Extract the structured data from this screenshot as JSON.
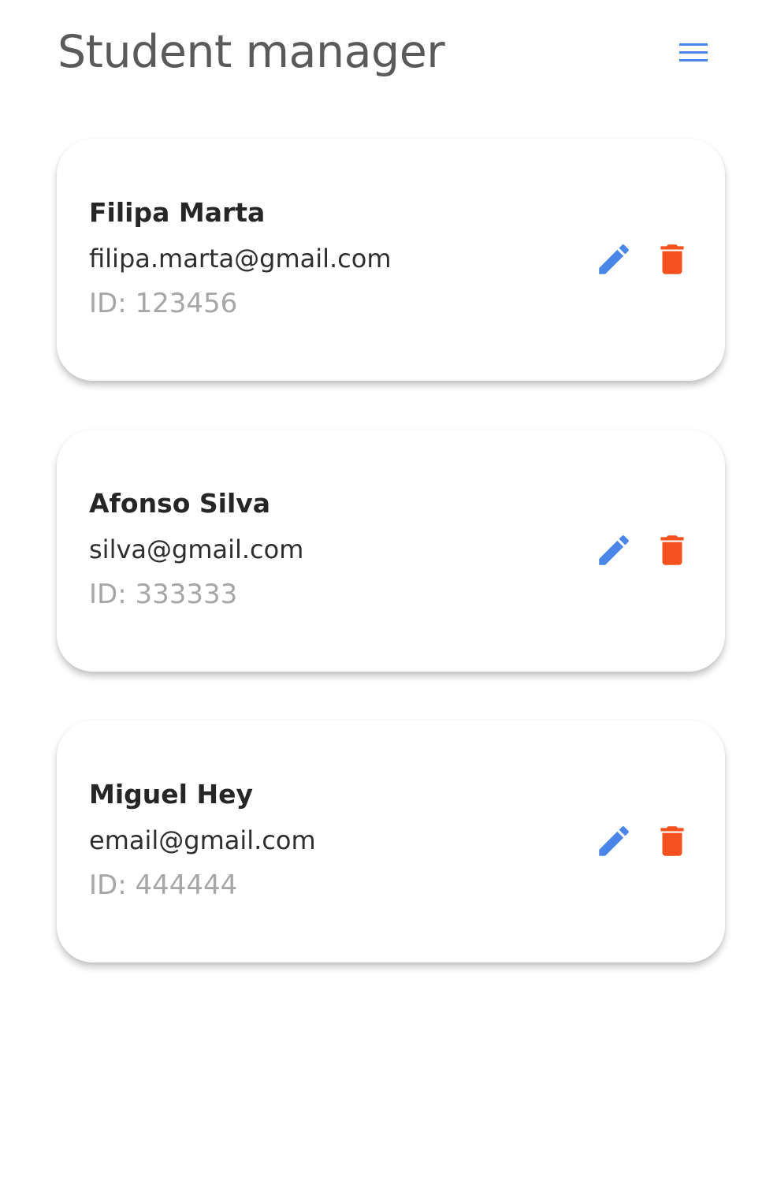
{
  "header": {
    "title": "Student manager",
    "menu_icon": "menu-icon"
  },
  "colors": {
    "accent": "#4a86e8",
    "danger": "#f4511e",
    "title_text": "#5a5a5a",
    "id_text": "#a6a6a6"
  },
  "students": [
    {
      "name": "Filipa Marta",
      "email": "filipa.marta@gmail.com",
      "id": "ID: 123456",
      "edit_icon": "pencil-icon",
      "delete_icon": "trash-icon"
    },
    {
      "name": "Afonso Silva",
      "email": "silva@gmail.com",
      "id": "ID: 333333",
      "edit_icon": "pencil-icon",
      "delete_icon": "trash-icon"
    },
    {
      "name": "Miguel Hey",
      "email": "email@gmail.com",
      "id": "ID: 444444",
      "edit_icon": "pencil-icon",
      "delete_icon": "trash-icon"
    }
  ]
}
